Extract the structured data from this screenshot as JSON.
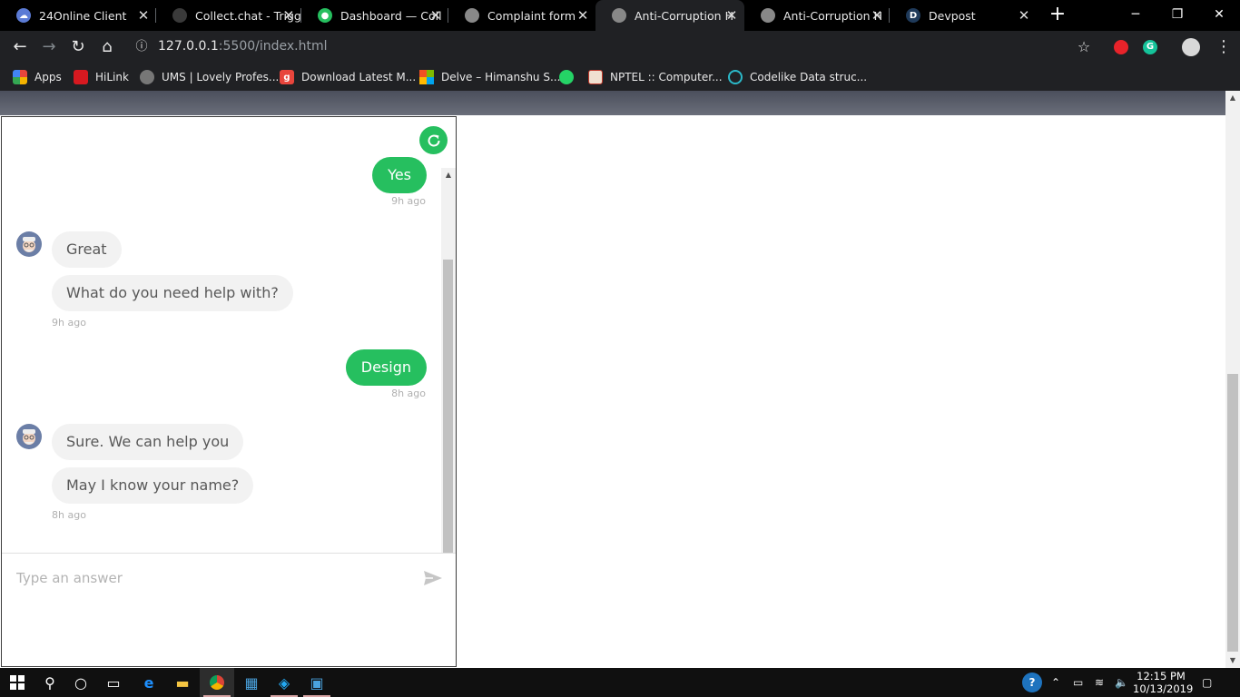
{
  "browser": {
    "tabs": [
      {
        "title": "24Online Client",
        "color": "#5b7bd5",
        "icon": "cloud-icon"
      },
      {
        "title": "Collect.chat - Trigg",
        "color": "#3a3a3a",
        "icon": "chat-icon"
      },
      {
        "title": "Dashboard — Coll",
        "color": "#26bf5f",
        "icon": "chat-icon"
      },
      {
        "title": "Complaint form",
        "color": "#888888",
        "icon": "globe-icon"
      },
      {
        "title": "Anti-Corruption H",
        "color": "#888888",
        "icon": "globe-icon",
        "active": true
      },
      {
        "title": "Anti-Corruption H",
        "color": "#888888",
        "icon": "globe-icon"
      },
      {
        "title": "Devpost",
        "color": "#1f3a5a",
        "icon": "devpost-icon",
        "letter": "D"
      }
    ],
    "address": {
      "host": "127.0.0.1",
      "rest": ":5500/index.html"
    },
    "bookmarks": [
      {
        "label": "Apps",
        "color": "#e8453c",
        "icon": "apps-grid-icon"
      },
      {
        "label": "HiLink",
        "color": "#d71920",
        "icon": "huawei-icon"
      },
      {
        "label": "UMS | Lovely Profes...",
        "color": "#777777",
        "icon": "globe-icon"
      },
      {
        "label": "Download Latest M...",
        "color": "#e8453c",
        "icon": "gaana-icon",
        "letter": "g"
      },
      {
        "label": "Delve – Himanshu S...",
        "color": "#f25022",
        "icon": "microsoft-icon"
      },
      {
        "label": "",
        "color": "#25d366",
        "icon": "whatsapp-icon"
      },
      {
        "label": "NPTEL :: Computer...",
        "color": "#c0392b",
        "icon": "nptel-icon"
      },
      {
        "label": "Codelike Data struc...",
        "color": "#2bb9c9",
        "icon": "circle-icon"
      }
    ]
  },
  "chat": {
    "user_messages": [
      {
        "text": "Yes",
        "time": "9h ago"
      },
      {
        "text": "Design",
        "time": "8h ago"
      }
    ],
    "bot_groups": [
      {
        "messages": [
          "Great",
          "What do you need help with?"
        ],
        "time": "9h ago"
      },
      {
        "messages": [
          "Sure. We can help you",
          "May I know your name?"
        ],
        "time": "8h ago"
      }
    ],
    "input_placeholder": "Type an answer",
    "accent": "#26bf5f"
  },
  "taskbar": {
    "time": "12:15 PM",
    "date": "10/13/2019"
  }
}
